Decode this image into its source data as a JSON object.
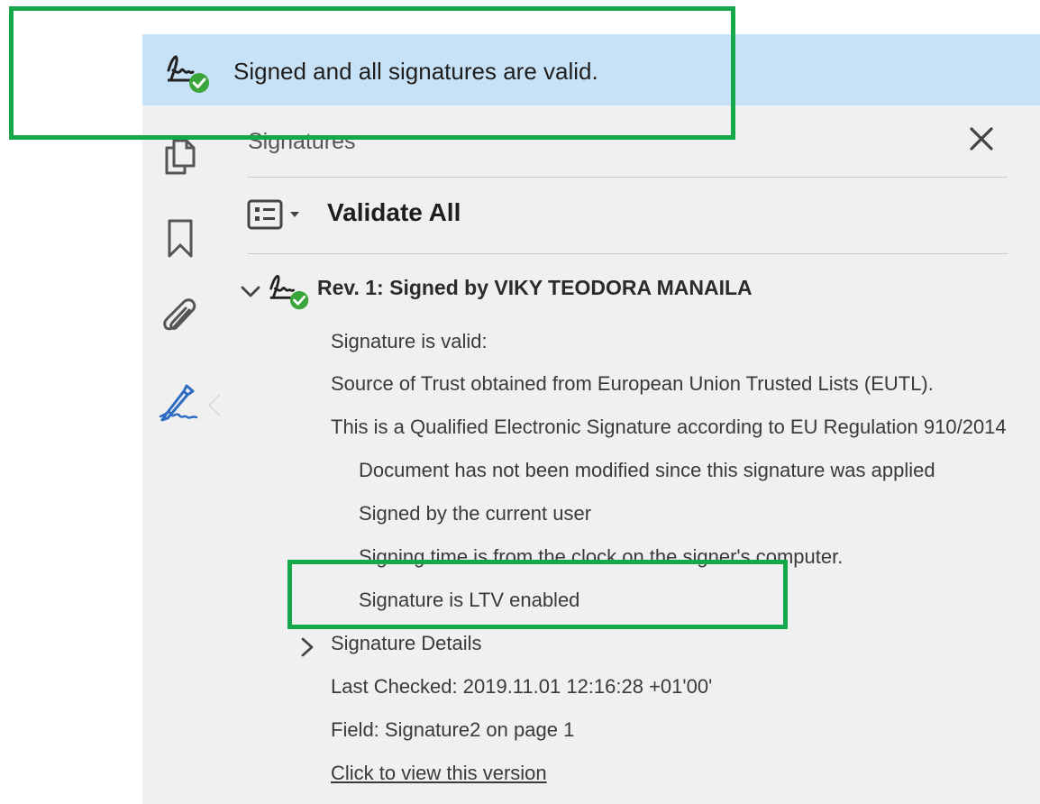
{
  "banner": {
    "text": "Signed and all signatures are valid.",
    "icon": "signature-valid-icon"
  },
  "rail": {
    "items": [
      "pages-icon",
      "bookmark-icon",
      "attachment-icon",
      "signature-pen-icon"
    ],
    "active_color": "#2d6cc0"
  },
  "panel": {
    "title": "Signatures",
    "validate_all_label": "Validate All",
    "revision": {
      "title": "Rev. 1: Signed by VIKY TEODORA MANAILA",
      "summary_lines": [
        "Signature is valid:",
        "Source of Trust obtained from European Union Trusted Lists (EUTL).",
        "This is a Qualified Electronic Signature according to EU Regulation 910/2014"
      ],
      "detail_lines": [
        "Document has not been modified since this signature was applied",
        "Signed by the current user",
        "Signing time is from the clock on the signer's computer.",
        "Signature is LTV enabled"
      ],
      "signature_details_label": "Signature Details",
      "last_checked": "Last Checked: 2019.11.01 12:16:28 +01'00'",
      "field": "Field: Signature2 on page 1",
      "view_version_link": "Click to view this version"
    }
  },
  "colors": {
    "banner_bg": "#c7e1f6",
    "highlight_box": "#15a84a",
    "valid_check": "#3aa53a"
  }
}
